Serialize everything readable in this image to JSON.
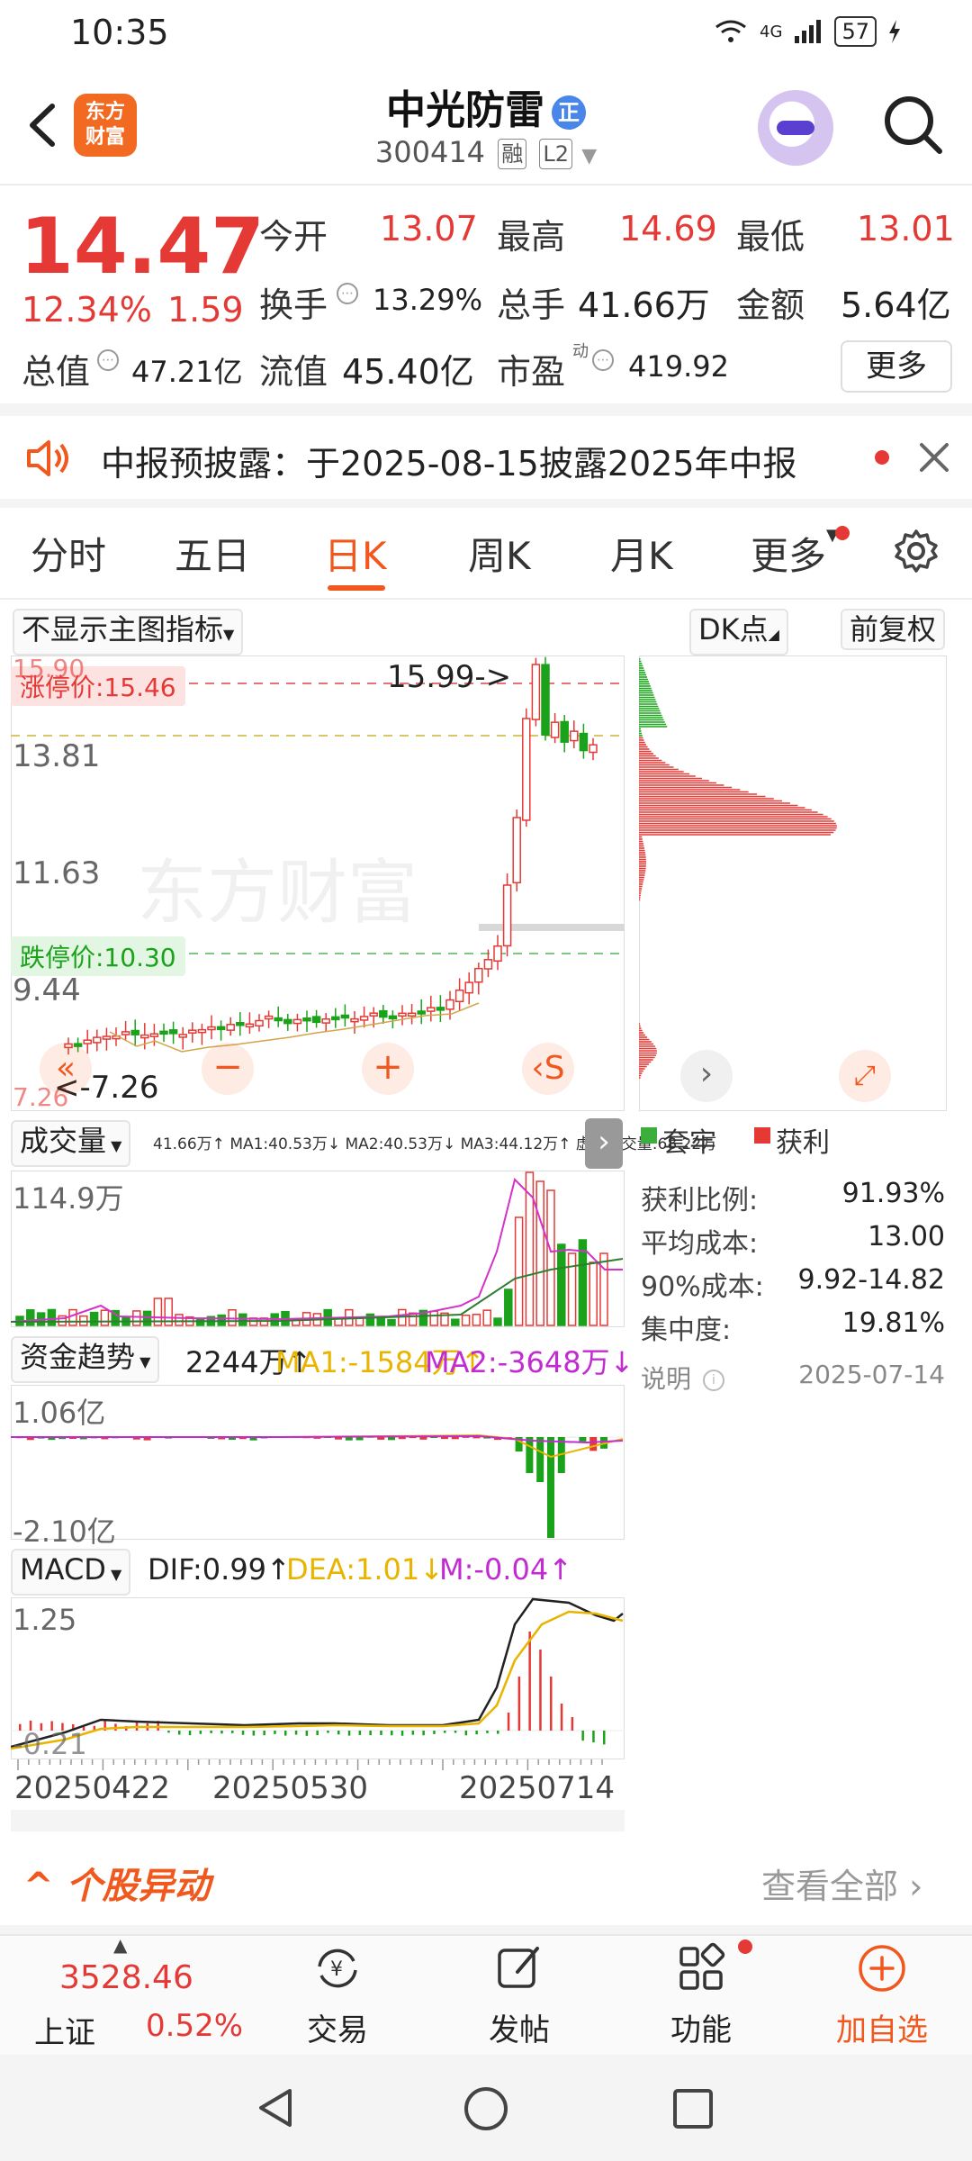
{
  "status": {
    "time": "10:35",
    "network": "4G",
    "battery": "57"
  },
  "header": {
    "logo_line1": "东方",
    "logo_line2": "财富",
    "stock_name": "中光防雷",
    "name_badge": "正",
    "stock_code": "300414",
    "tag_margin": "融",
    "tag_level": "L2"
  },
  "quote": {
    "price": "14.47",
    "change_pct": "12.34%",
    "change": "1.59",
    "open_label": "今开",
    "open": "13.07",
    "high_label": "最高",
    "high": "14.69",
    "low_label": "最低",
    "low": "13.01",
    "turnover_label": "换手",
    "turnover": "13.29%",
    "volume_label": "总手",
    "volume": "41.66万",
    "amount_label": "金额",
    "amount": "5.64亿",
    "mktcap_label": "总值",
    "mktcap": "47.21亿",
    "float_label": "流值",
    "float_cap": "45.40亿",
    "pe_label": "市盈",
    "pe_sup": "动",
    "pe": "419.92",
    "more_label": "更多"
  },
  "notice": {
    "text": "中报预披露：于2025-08-15披露2025年中报"
  },
  "tabs": [
    {
      "label": "分时"
    },
    {
      "label": "五日"
    },
    {
      "label": "日K"
    },
    {
      "label": "周K"
    },
    {
      "label": "月K"
    },
    {
      "label": "更多"
    }
  ],
  "chart_controls": {
    "indicator_select": "不显示主图指标",
    "dk_point": "DK点",
    "adjust": "前复权"
  },
  "kline": {
    "limit_up": "涨停价:15.46",
    "limit_down": "跌停价:10.30",
    "top_tick": "15.90",
    "y_ticks": [
      "13.81",
      "11.63",
      "9.44",
      "7.26"
    ],
    "max_marker": "15.99->",
    "min_marker": "<-7.26",
    "dates": [
      "20250422",
      "20250530",
      "20250714"
    ]
  },
  "volume_panel": {
    "select": "成交量",
    "summary": "41.66万↑ MA1:40.53万↓ MA2:40.53万↓ MA3:44.12万↑ 虚拟成交量:68.22万",
    "y_top": "114.9万"
  },
  "fund_panel": {
    "select": "资金趋势",
    "value": "2244万↑",
    "ma1": "MA1:-1584万↑",
    "ma2": "MA2:-3648万↓",
    "y_top": "1.06亿",
    "y_bottom": "-2.10亿"
  },
  "macd_panel": {
    "select": "MACD",
    "dif": "DIF:0.99↑",
    "dea": "DEA:1.01↓",
    "m": "M:-0.04↑",
    "y_top": "1.25",
    "y_bottom": "-0.21"
  },
  "chips": {
    "legend_trapped": "套牢",
    "legend_profit": "获利",
    "profit_ratio_label": "获利比例:",
    "profit_ratio": "91.93%",
    "avg_cost_label": "平均成本:",
    "avg_cost": "13.00",
    "cost90_label": "90%成本:",
    "cost90": "9.92-14.82",
    "concentration_label": "集中度:",
    "concentration": "19.81%",
    "note_label": "说明",
    "date": "2025-07-14"
  },
  "movement": {
    "title": "个股异动",
    "view_all": "查看全部"
  },
  "bottom_nav": {
    "index_value": "3528.46",
    "index_name": "上证",
    "index_pct": "0.52%",
    "items": [
      {
        "label": "交易"
      },
      {
        "label": "发帖"
      },
      {
        "label": "功能"
      },
      {
        "label": "加自选"
      }
    ]
  },
  "colors": {
    "up": "#e53935",
    "down": "#1aa31a",
    "accent": "#f0581d"
  }
}
